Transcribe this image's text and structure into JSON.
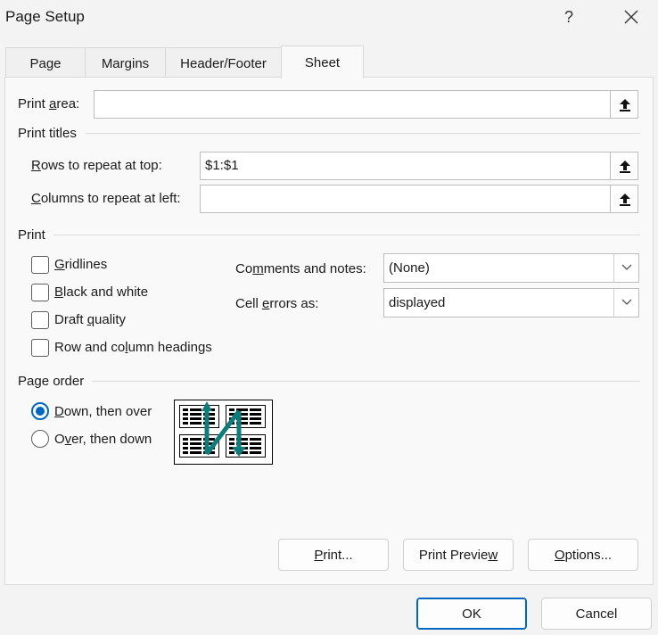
{
  "window": {
    "title": "Page Setup",
    "help": "?",
    "close": "✕"
  },
  "tabs": [
    {
      "label": "Page"
    },
    {
      "label": "Margins"
    },
    {
      "label": "Header/Footer"
    },
    {
      "label": "Sheet"
    }
  ],
  "print_area": {
    "label_pre": "Print ",
    "label_key": "a",
    "label_post": "rea:",
    "value": ""
  },
  "print_titles": {
    "heading": "Print titles",
    "rows": {
      "label_key": "R",
      "label_post": "ows to repeat at top:",
      "value": "$1:$1"
    },
    "cols": {
      "label_key": "C",
      "label_post": "olumns to repeat at left:",
      "value": ""
    }
  },
  "print": {
    "heading": "Print",
    "gridlines": {
      "label_key": "G",
      "label_post": "ridlines",
      "checked": false
    },
    "black_white": {
      "label_key": "B",
      "label_post": "lack and white",
      "checked": false
    },
    "draft": {
      "label_pre": "Draft ",
      "label_key": "q",
      "label_post": "uality",
      "checked": false
    },
    "headings": {
      "label_pre": "Row and co",
      "label_key": "l",
      "label_post": "umn headings",
      "checked": false
    },
    "comments": {
      "label_pre": "Co",
      "label_key": "m",
      "label_post": "ments and notes:",
      "value": "(None)"
    },
    "cell_errors": {
      "label_pre": "Cell ",
      "label_key": "e",
      "label_post": "rrors as:",
      "value": "displayed"
    }
  },
  "page_order": {
    "heading": "Page order",
    "down_over": {
      "label_key": "D",
      "label_post": "own, then over",
      "selected": true
    },
    "over_down": {
      "label_pre": "O",
      "label_key": "v",
      "label_post": "er, then down",
      "selected": false
    }
  },
  "buttons": {
    "print": {
      "label_key": "P",
      "label_post": "rint..."
    },
    "preview": {
      "label_pre": "Print Previe",
      "label_key": "w",
      "label_post": ""
    },
    "options": {
      "label_key": "O",
      "label_post": "ptions..."
    },
    "ok": "OK",
    "cancel": "Cancel"
  },
  "colors": {
    "accent": "#0067c0",
    "arrow": "#0e7c7b"
  }
}
